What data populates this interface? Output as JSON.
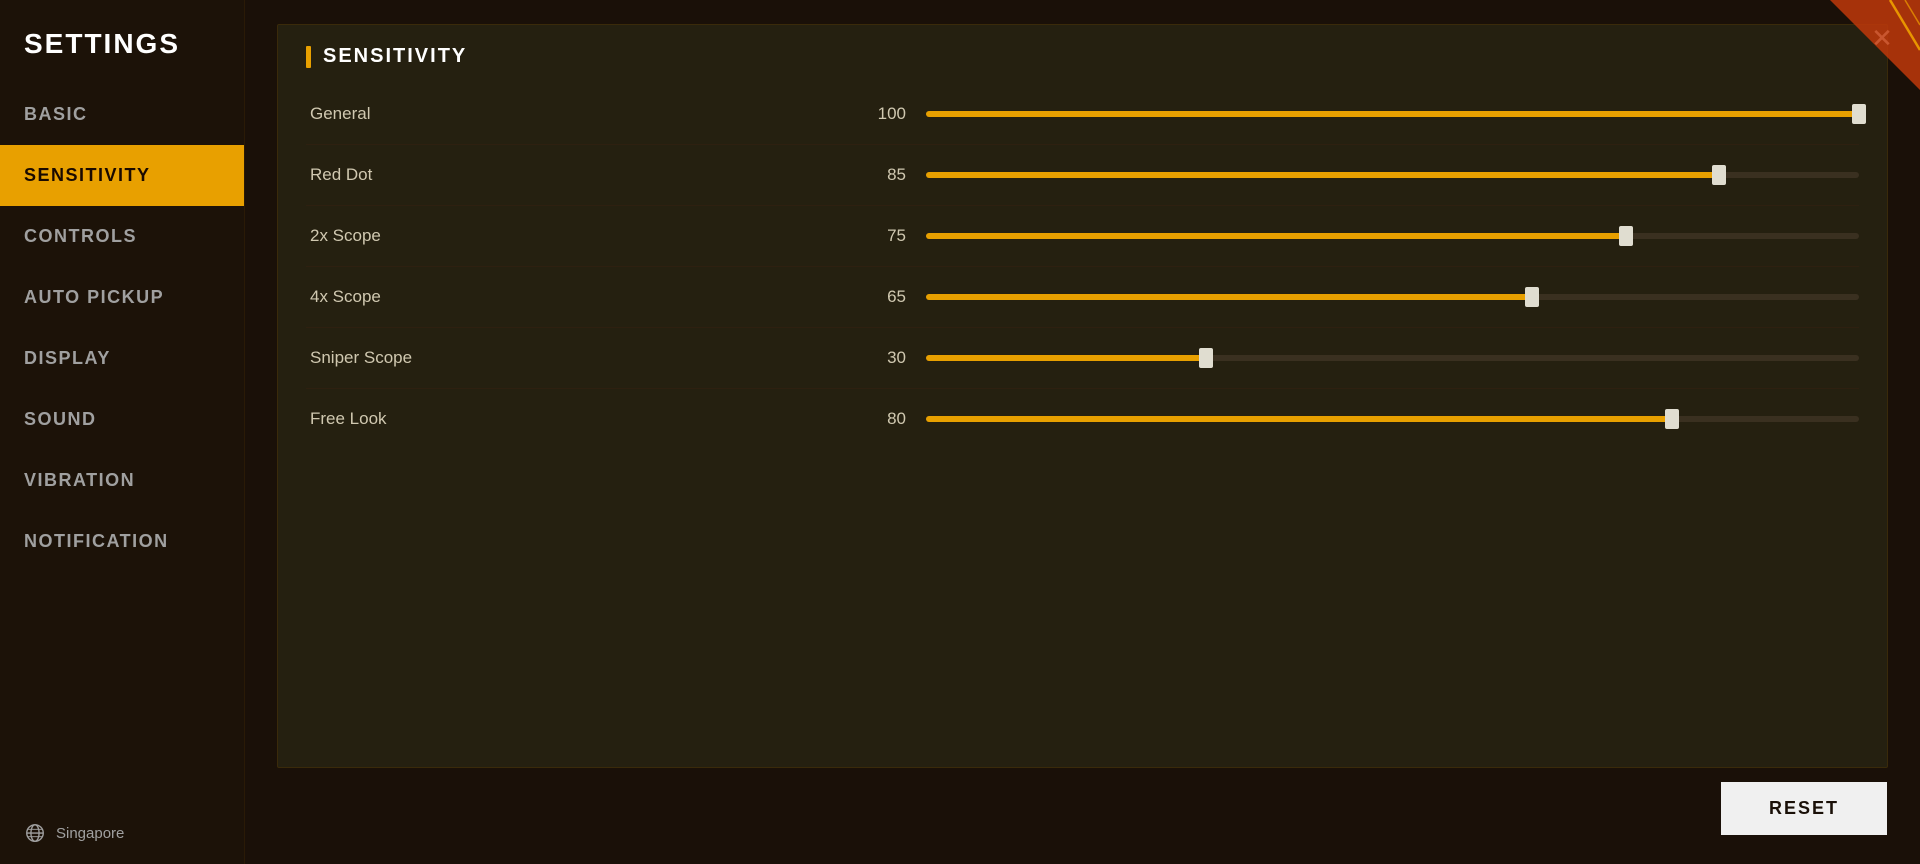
{
  "sidebar": {
    "title": "SETTINGS",
    "nav_items": [
      {
        "id": "basic",
        "label": "BASIC",
        "active": false
      },
      {
        "id": "sensitivity",
        "label": "SENSITIVITY",
        "active": true
      },
      {
        "id": "controls",
        "label": "CONTROLS",
        "active": false
      },
      {
        "id": "auto-pickup",
        "label": "AUTO PICKUP",
        "active": false
      },
      {
        "id": "display",
        "label": "DISPLAY",
        "active": false
      },
      {
        "id": "sound",
        "label": "SOUND",
        "active": false
      },
      {
        "id": "vibration",
        "label": "VIBRATION",
        "active": false
      },
      {
        "id": "notification",
        "label": "NOTIFICATION",
        "active": false
      }
    ],
    "footer": {
      "region": "Singapore",
      "globe_icon": "🌐"
    }
  },
  "main": {
    "panel_title": "SENSITIVITY",
    "close_label": "✕",
    "reset_label": "RESET",
    "sliders": [
      {
        "id": "general",
        "label": "General",
        "value": 100,
        "percent": 100
      },
      {
        "id": "red-dot",
        "label": "Red Dot",
        "value": 85,
        "percent": 85
      },
      {
        "id": "2x-scope",
        "label": "2x Scope",
        "value": 75,
        "percent": 75
      },
      {
        "id": "4x-scope",
        "label": "4x Scope",
        "value": 65,
        "percent": 65
      },
      {
        "id": "sniper-scope",
        "label": "Sniper Scope",
        "value": 30,
        "percent": 30
      },
      {
        "id": "free-look",
        "label": "Free Look",
        "value": 80,
        "percent": 80
      }
    ]
  },
  "colors": {
    "accent": "#e8a000",
    "active_nav_bg": "#e8a000",
    "active_nav_text": "#1a0a00",
    "slider_fill": "#e8a000",
    "slider_track": "#3a3020",
    "thumb": "#e0ddd0"
  }
}
